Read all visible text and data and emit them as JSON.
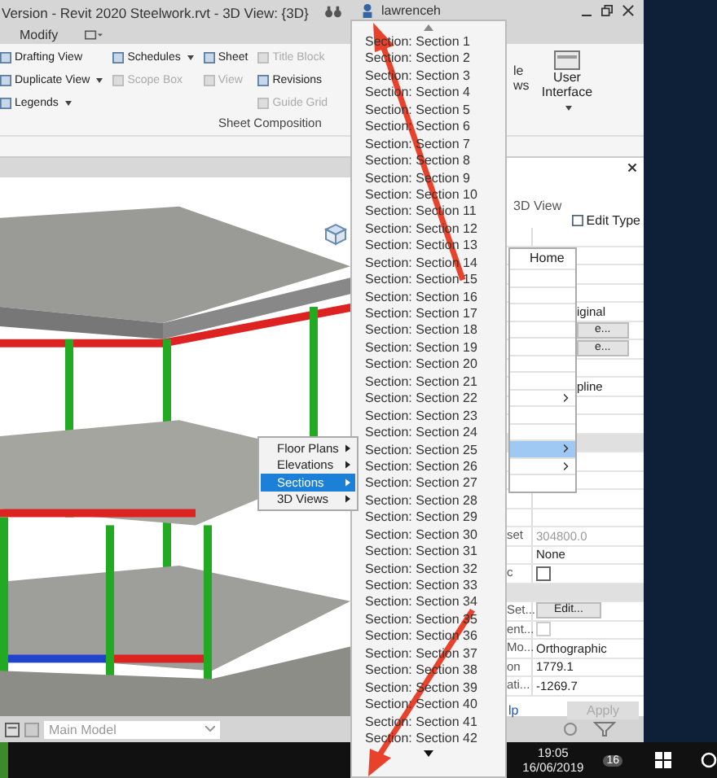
{
  "window": {
    "title": "Version - Revit 2020 Steelwork.rvt - 3D View: {3D}",
    "user": "lawrenceh"
  },
  "ribbon": {
    "tabs": [
      {
        "label": "Modify",
        "selected": false
      }
    ],
    "columns": [
      [
        {
          "label": "Drafting View",
          "disabled": false,
          "dropdown": false
        },
        {
          "label": "Duplicate View",
          "disabled": false,
          "dropdown": true
        },
        {
          "label": "Legends",
          "disabled": false,
          "dropdown": true
        }
      ],
      [
        {
          "label": "Schedules",
          "disabled": false,
          "dropdown": true
        },
        {
          "label": "Scope Box",
          "disabled": true,
          "dropdown": false
        }
      ],
      [
        {
          "label": "Sheet",
          "disabled": false,
          "dropdown": false
        },
        {
          "label": "View",
          "disabled": true,
          "dropdown": false
        }
      ],
      [
        {
          "label": "Title Block",
          "disabled": true,
          "dropdown": false
        },
        {
          "label": "Revisions",
          "disabled": false,
          "dropdown": false
        },
        {
          "label": "Guide Grid",
          "disabled": true,
          "dropdown": false
        }
      ]
    ],
    "group_label": "Sheet Composition",
    "cut_button": [
      "le",
      "ws"
    ],
    "user_interface": {
      "label": "User Interface",
      "dropdown": true
    }
  },
  "section_list": {
    "items": [
      "Section: Section 1",
      "Section: Section 2",
      "Section: Section 3",
      "Section: Section 4",
      "Section: Section 5",
      "Section: Section 6",
      "Section: Section 7",
      "Section: Section 8",
      "Section: Section 9",
      "Section: Section 10",
      "Section: Section 11",
      "Section: Section 12",
      "Section: Section 13",
      "Section: Section 14",
      "Section: Section 15",
      "Section: Section 16",
      "Section: Section 17",
      "Section: Section 18",
      "Section: Section 19",
      "Section: Section 20",
      "Section: Section 21",
      "Section: Section 22",
      "Section: Section 23",
      "Section: Section 24",
      "Section: Section 25",
      "Section: Section 26",
      "Section: Section 27",
      "Section: Section 28",
      "Section: Section 29",
      "Section: Section 30",
      "Section: Section 31",
      "Section: Section 32",
      "Section: Section 33",
      "Section: Section 34",
      "Section: Section 35",
      "Section: Section 36",
      "Section: Section 37",
      "Section: Section 38",
      "Section: Section 39",
      "Section: Section 40",
      "Section: Section 41",
      "Section: Section 42"
    ]
  },
  "context_menu": {
    "items": [
      {
        "label": "Floor Plans",
        "selected": false
      },
      {
        "label": "Elevations",
        "selected": false
      },
      {
        "label": "Sections",
        "selected": true
      },
      {
        "label": "3D Views",
        "selected": false
      }
    ]
  },
  "home_menu": {
    "label": "Home",
    "rows": [
      {
        "submenu": false,
        "selected": false
      },
      {
        "submenu": false,
        "selected": false
      },
      {
        "submenu": false,
        "selected": false
      },
      {
        "submenu": false,
        "selected": false
      },
      {
        "submenu": false,
        "selected": false
      },
      {
        "submenu": false,
        "selected": false
      },
      {
        "submenu": false,
        "selected": false
      },
      {
        "submenu": true,
        "selected": false
      },
      {
        "submenu": false,
        "selected": false
      },
      {
        "submenu": false,
        "selected": false
      },
      {
        "submenu": true,
        "selected": true
      },
      {
        "submenu": true,
        "selected": false
      },
      {
        "submenu": false,
        "selected": false
      }
    ]
  },
  "properties": {
    "type": "3D View",
    "edit_type": "Edit Type",
    "rows": [
      {
        "kind": "value"
      },
      {
        "kind": "value"
      },
      {
        "kind": "value"
      },
      {
        "kind": "value"
      },
      {
        "kind": "value",
        "value": "iginal"
      },
      {
        "kind": "button",
        "value": "e..."
      },
      {
        "kind": "button",
        "value": "e..."
      },
      {
        "kind": "value"
      },
      {
        "kind": "value",
        "value": "pline"
      },
      {
        "kind": "value"
      },
      {
        "kind": "value"
      },
      {
        "kind": "header"
      },
      {
        "kind": "value"
      },
      {
        "kind": "value"
      },
      {
        "kind": "value"
      },
      {
        "kind": "value"
      },
      {
        "kind": "value",
        "label": "set",
        "value": "304800.0",
        "disabled": true
      },
      {
        "kind": "value",
        "value": "None"
      },
      {
        "kind": "checkbox",
        "label": "c",
        "checked": false,
        "disabled": false
      },
      {
        "kind": "header"
      },
      {
        "kind": "button",
        "label": "Set...",
        "value": "Edit..."
      },
      {
        "kind": "checkbox",
        "label": "ent...",
        "checked": false,
        "disabled": true
      },
      {
        "kind": "value",
        "label": "Mo...",
        "value": "Orthographic"
      },
      {
        "kind": "value",
        "label": "on",
        "value": "1779.1"
      },
      {
        "kind": "value",
        "label": "ati...",
        "value": "-1269.7"
      }
    ],
    "help_link": "lp",
    "apply": {
      "label": "Apply",
      "disabled": true
    }
  },
  "status_bar": {
    "model": "Main Model"
  },
  "taskbar": {
    "time": "19:05",
    "date": "16/06/2019",
    "notifications": "16"
  }
}
